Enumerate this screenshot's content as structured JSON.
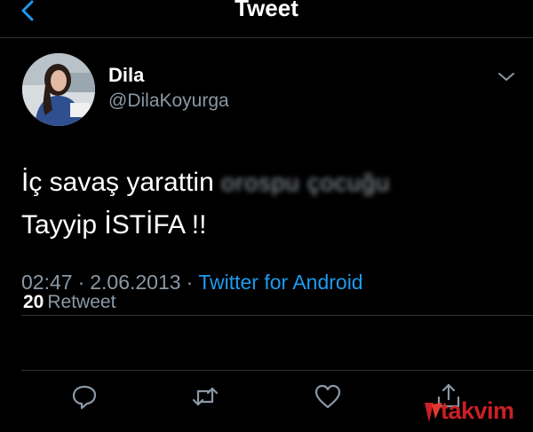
{
  "header": {
    "title": "Tweet"
  },
  "tweet": {
    "author": {
      "name": "Dila",
      "handle": "@DilaKoyurga"
    },
    "text": {
      "line1_visible": "İç savaş yarattin",
      "line1_blurred": "orospu çocuğu",
      "line2": "Tayyip İSTİFA !!"
    },
    "time": "02:47",
    "date": "2.06.2013",
    "separator": "·",
    "source": "Twitter for Android",
    "retweets": {
      "count": "20",
      "label": "Retweet"
    }
  },
  "actions": [
    "reply-icon",
    "retweet-icon",
    "like-icon",
    "share-icon"
  ],
  "watermark": {
    "text": "takvim"
  },
  "colors": {
    "background": "#000000",
    "text": "#ffffff",
    "secondary": "#8b98a5",
    "accent": "#1d9bf0",
    "divider": "#2f3336",
    "watermark": "#cc1f26"
  }
}
